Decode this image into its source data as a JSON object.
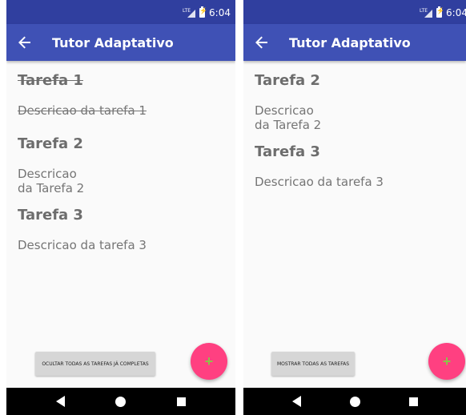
{
  "status": {
    "network": "LTE",
    "time": "6:04"
  },
  "appbar": {
    "title": "Tutor Adaptativo"
  },
  "left_screen": {
    "tasks": [
      {
        "title": "Tarefa 1",
        "description": "Descricao da tarefa 1",
        "completed": true
      },
      {
        "title": "Tarefa 2",
        "description": "Descricao\nda Tarefa 2",
        "completed": false
      },
      {
        "title": "Tarefa 3",
        "description": "Descricao da tarefa 3",
        "completed": false
      }
    ],
    "toggle_button": "OCULTAR TODAS AS TAREFAS JÁ COMPLETAS"
  },
  "right_screen": {
    "tasks": [
      {
        "title": "Tarefa 2",
        "description": "Descricao\nda Tarefa 2",
        "completed": false
      },
      {
        "title": "Tarefa 3",
        "description": "Descricao da tarefa 3",
        "completed": false
      }
    ],
    "toggle_button": "MOSTRAR TODAS AS TAREFAS"
  },
  "fab": {
    "icon": "plus-icon",
    "label": "+"
  },
  "colors": {
    "status_bar": "#303f9f",
    "app_bar": "#3f51b5",
    "fab": "#ff4081",
    "fab_icon": "#8bc34a"
  }
}
